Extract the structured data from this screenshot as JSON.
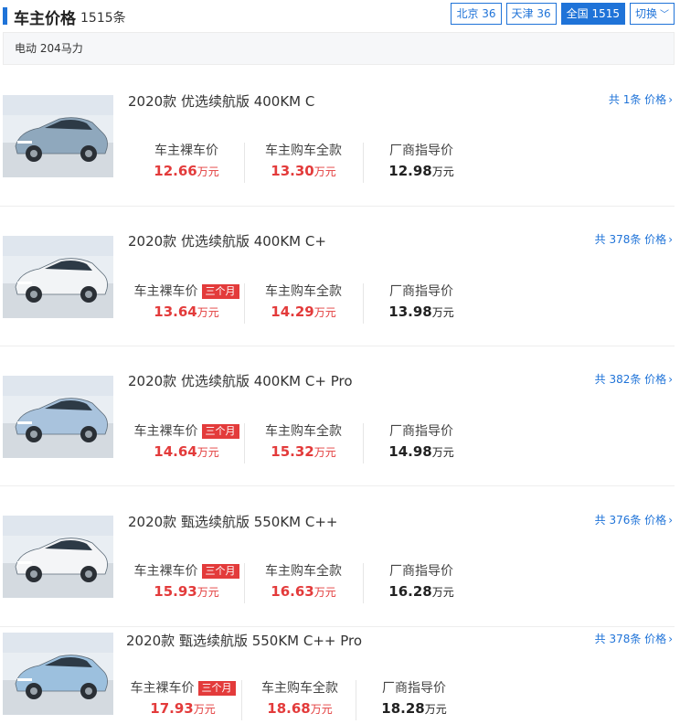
{
  "header": {
    "title": "车主价格",
    "count": "1515条",
    "regions": [
      {
        "label": "北京 36",
        "active": false
      },
      {
        "label": "天津 36",
        "active": false
      },
      {
        "label": "全国 1515",
        "active": true
      }
    ],
    "switch_label": "切换"
  },
  "filter": {
    "text": "电动 204马力"
  },
  "price_labels": {
    "owner_price": "车主裸车价",
    "owner_total": "车主购车全款",
    "guide_price": "厂商指导价",
    "unit": "万元"
  },
  "listings": [
    {
      "model": "2020款 优选续航版 400KM C",
      "more": "共 1条 价格",
      "badge": "",
      "owner_price": "12.66",
      "owner_total": "13.30",
      "guide_price": "12.98",
      "car_color": "#8fa8bd"
    },
    {
      "model": "2020款 优选续航版 400KM C+",
      "more": "共 378条 价格",
      "badge": "三个月",
      "owner_price": "13.64",
      "owner_total": "14.29",
      "guide_price": "13.98",
      "car_color": "#f2f4f6"
    },
    {
      "model": "2020款 优选续航版 400KM C+ Pro",
      "more": "共 382条 价格",
      "badge": "三个月",
      "owner_price": "14.64",
      "owner_total": "15.32",
      "guide_price": "14.98",
      "car_color": "#a9c3dd"
    },
    {
      "model": "2020款 甄选续航版 550KM C++",
      "more": "共 376条 价格",
      "badge": "三个月",
      "owner_price": "15.93",
      "owner_total": "16.63",
      "guide_price": "16.28",
      "car_color": "#f4f5f7"
    },
    {
      "model": "2020款 甄选续航版 550KM C++ Pro",
      "more": "共 378条 价格",
      "badge": "三个月",
      "owner_price": "17.93",
      "owner_total": "18.68",
      "guide_price": "18.28",
      "car_color": "#9cc0de"
    }
  ]
}
